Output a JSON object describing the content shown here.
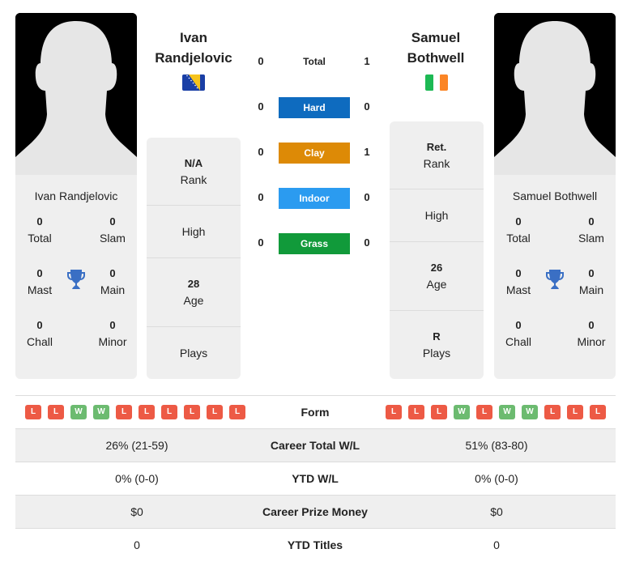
{
  "colors": {
    "hard": "#0e6bbf",
    "clay": "#dd8a06",
    "indoor": "#2b9bf0",
    "grass": "#119a3a",
    "loss": "#ed5a45",
    "win": "#6cbb70",
    "trophy": "#3a6fc4"
  },
  "player1": {
    "name_line1": "Ivan",
    "name_line2": "Randjelovic",
    "full_name": "Ivan Randjelovic",
    "flag": "bosnia-herzegovina-flag",
    "titles": {
      "total": {
        "value": "0",
        "label": "Total"
      },
      "slam": {
        "value": "0",
        "label": "Slam"
      },
      "mast": {
        "value": "0",
        "label": "Mast"
      },
      "main": {
        "value": "0",
        "label": "Main"
      },
      "chall": {
        "value": "0",
        "label": "Chall"
      },
      "minor": {
        "value": "0",
        "label": "Minor"
      }
    },
    "info": {
      "rank": {
        "value": "N/A",
        "label": "Rank"
      },
      "high": {
        "value": "",
        "label": "High"
      },
      "age": {
        "value": "28",
        "label": "Age"
      },
      "plays": {
        "value": "",
        "label": "Plays"
      }
    },
    "form": [
      "L",
      "L",
      "W",
      "W",
      "L",
      "L",
      "L",
      "L",
      "L",
      "L"
    ]
  },
  "player2": {
    "name_line1": "Samuel",
    "name_line2": "Bothwell",
    "full_name": "Samuel Bothwell",
    "flag": "ireland-flag",
    "titles": {
      "total": {
        "value": "0",
        "label": "Total"
      },
      "slam": {
        "value": "0",
        "label": "Slam"
      },
      "mast": {
        "value": "0",
        "label": "Mast"
      },
      "main": {
        "value": "0",
        "label": "Main"
      },
      "chall": {
        "value": "0",
        "label": "Chall"
      },
      "minor": {
        "value": "0",
        "label": "Minor"
      }
    },
    "info": {
      "rank": {
        "value": "Ret.",
        "label": "Rank"
      },
      "high": {
        "value": "",
        "label": "High"
      },
      "age": {
        "value": "26",
        "label": "Age"
      },
      "plays": {
        "value": "R",
        "label": "Plays"
      }
    },
    "form": [
      "L",
      "L",
      "L",
      "W",
      "L",
      "W",
      "W",
      "L",
      "L",
      "L"
    ]
  },
  "h2h": {
    "total": {
      "label": "Total",
      "p1": "0",
      "p2": "1"
    },
    "hard": {
      "label": "Hard",
      "p1": "0",
      "p2": "0"
    },
    "clay": {
      "label": "Clay",
      "p1": "0",
      "p2": "1"
    },
    "indoor": {
      "label": "Indoor",
      "p1": "0",
      "p2": "0"
    },
    "grass": {
      "label": "Grass",
      "p1": "0",
      "p2": "0"
    }
  },
  "stats": {
    "form_label": "Form",
    "rows": [
      {
        "label": "Career Total W/L",
        "p1": "26% (21-59)",
        "p2": "51% (83-80)"
      },
      {
        "label": "YTD W/L",
        "p1": "0% (0-0)",
        "p2": "0% (0-0)"
      },
      {
        "label": "Career Prize Money",
        "p1": "$0",
        "p2": "$0"
      },
      {
        "label": "YTD Titles",
        "p1": "0",
        "p2": "0"
      }
    ]
  }
}
